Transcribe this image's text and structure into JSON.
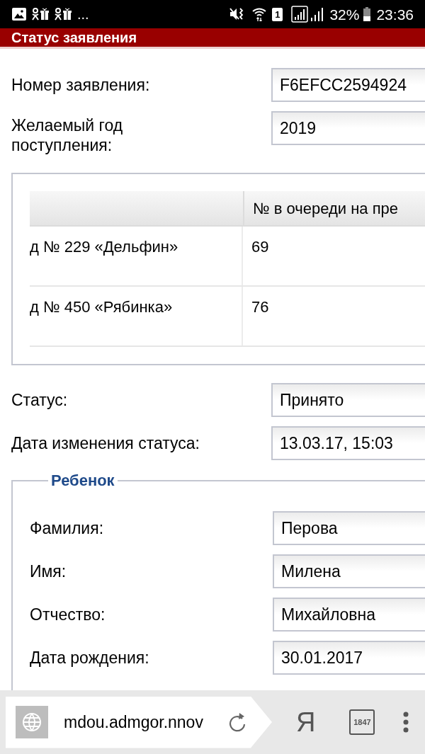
{
  "status_bar": {
    "more_notifications": "...",
    "sim_slot": "1",
    "battery": "32%",
    "time": "23:36"
  },
  "header": {
    "title": "Статус заявления"
  },
  "application_fields": [
    {
      "label": "Номер заявления:",
      "value": "F6EFCC2594924"
    },
    {
      "label": "Желаемый год поступления:",
      "value": "2019"
    }
  ],
  "queue_table": {
    "column_2_header": "№ в очереди на пре",
    "rows": [
      {
        "column_1": "д № 229 «Дельфин»",
        "column_2": "69"
      },
      {
        "column_1": "д № 450 «Рябинка»",
        "column_2": "76"
      }
    ]
  },
  "status_fields": [
    {
      "label": "Статус:",
      "value": "Принято"
    },
    {
      "label": "Дата изменения статуса:",
      "value": "13.03.17, 15:03"
    }
  ],
  "child_section": {
    "legend": "Ребенок",
    "fields": [
      {
        "label": "Фамилия:",
        "value": "Перова"
      },
      {
        "label": "Имя:",
        "value": "Милена"
      },
      {
        "label": "Отчество:",
        "value": "Михайловна"
      },
      {
        "label": "Дата рождения:",
        "value": "30.01.2017"
      }
    ]
  },
  "browser_bar": {
    "url": "mdou.admgor.nnov",
    "logo": "Я",
    "tab_count": "1847"
  }
}
